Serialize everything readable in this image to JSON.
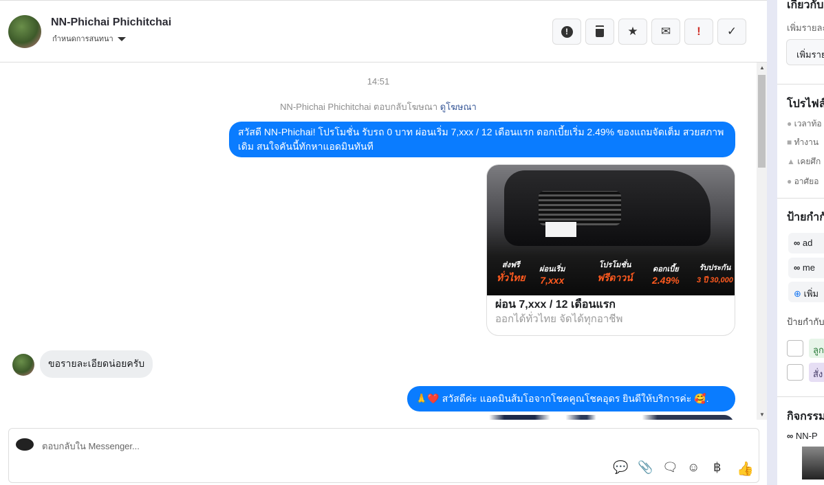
{
  "header": {
    "name": "NN-Phichai Phichitchai",
    "subtitle": "กำหนดการสนทนา",
    "buttons": [
      {
        "icon": "alert-circle-icon",
        "glyph": "❗"
      },
      {
        "icon": "trash-icon",
        "glyph": "🗑"
      },
      {
        "icon": "star-icon",
        "glyph": "★"
      },
      {
        "icon": "envelope-icon",
        "glyph": "✉"
      },
      {
        "icon": "exclamation-icon",
        "glyph": "!"
      },
      {
        "icon": "check-icon",
        "glyph": "✓"
      }
    ]
  },
  "chat": {
    "time": "14:51",
    "ad_reply": "NN-Phichai Phichitchai ตอบกลับโฆษณา",
    "ad_link": "ดูโฆษณา",
    "msg1": "สวัสดี NN-Phichai! โปรโมชั่น รับรถ 0 บาท ผ่อนเริ่ม 7,xxx / 12 เดือนแรก ดอกเบี้ยเริ่ม 2.49% ของแถมจัดเต็ม สวยสภาพเดิม สนใจคันนี้ทักหาแอดมินทันที",
    "card": {
      "title": "ผ่อน 7,xxx / 12 เดือนแรก",
      "subtitle": "ออกได้ทั่วไทย จัดได้ทุกอาชีพ",
      "promos": [
        {
          "t": "ส่งฟรี",
          "v": "ทั่วไทย"
        },
        {
          "t": "ผ่อนเริ่ม",
          "v": "7,xxx"
        },
        {
          "t": "โปรโมชั่น",
          "v": "ฟรีดาวน์"
        },
        {
          "t": "ดอกเบี้ย",
          "v": "2.49%"
        },
        {
          "t": "รับประกัน",
          "v": "3 ปี 30,000"
        }
      ]
    },
    "msg_in": "ขอรายละเอียดน่อยครับ",
    "msg2": "🙏❤️ สวัสดีค่ะ แอดมินส้มโอจากโชคคูณโชคอุดร ยินดีให้บริการค่ะ 🥰."
  },
  "composer": {
    "placeholder": "ตอบกลับใน Messenger..."
  },
  "sidebar": {
    "about": "เกี่ยวกับ",
    "about_sub": "เพิ่มรายละ",
    "about_btn": "เพิ่มราย",
    "profile": "โปรไฟล์",
    "rows": [
      "เวลาท้อ",
      "ทำงาน",
      "เคยศึก",
      "อาศัยอ"
    ],
    "labels": "ป้ายกำกั",
    "chips": [
      "ad",
      "me"
    ],
    "add": "เพิ่ม",
    "labels2": "ป้ายกำกับ",
    "tags": [
      "ลูก",
      "สั่ง"
    ],
    "activity": "กิจกรรม",
    "activity_item": "NN-P"
  }
}
